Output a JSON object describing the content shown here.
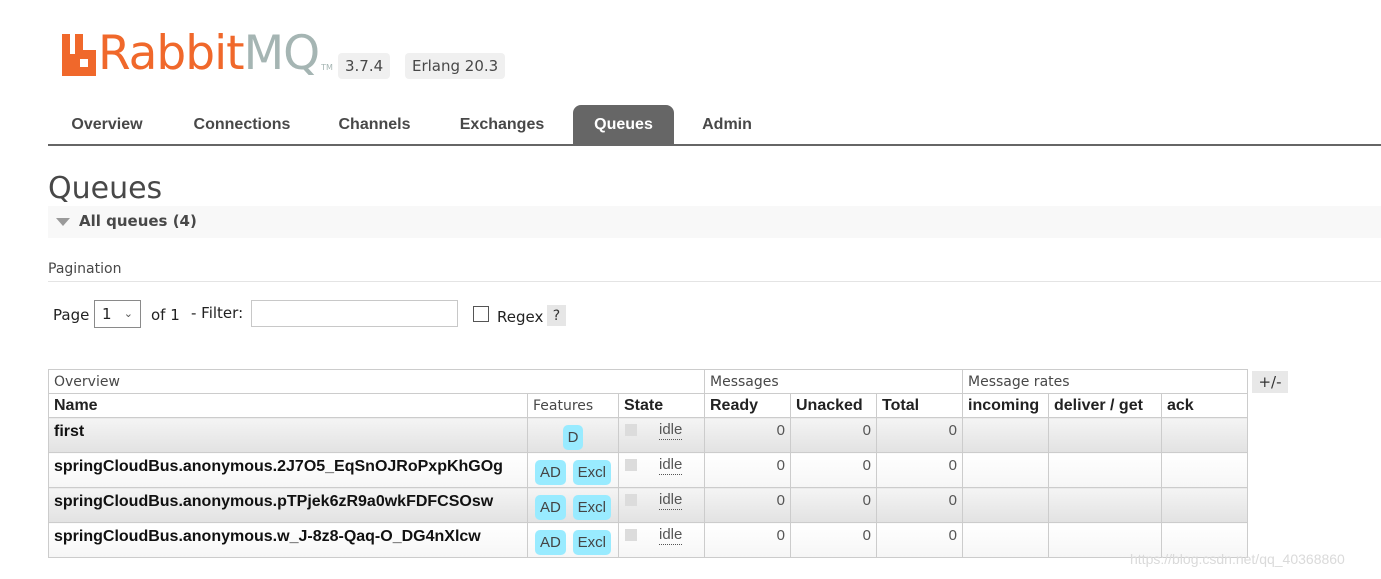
{
  "header": {
    "logo_rabbit": "Rabbit",
    "logo_mq": "MQ",
    "logo_tm": "TM",
    "version": "3.7.4",
    "erlang": "Erlang 20.3",
    "brand_color": "#f0682b"
  },
  "nav": {
    "tabs": [
      {
        "label": "Overview",
        "active": false
      },
      {
        "label": "Connections",
        "active": false
      },
      {
        "label": "Channels",
        "active": false
      },
      {
        "label": "Exchanges",
        "active": false
      },
      {
        "label": "Queues",
        "active": true
      },
      {
        "label": "Admin",
        "active": false
      }
    ]
  },
  "page": {
    "title": "Queues",
    "section_title": "All queues (4)"
  },
  "pagination": {
    "label": "Pagination",
    "page_label": "Page",
    "page_value": "1",
    "of_label": "of 1",
    "filter_label": "- Filter:",
    "filter_value": "",
    "regex_label": "Regex",
    "regex_checked": false,
    "help_label": "?"
  },
  "table": {
    "groups": {
      "overview": "Overview",
      "messages": "Messages",
      "rates": "Message rates"
    },
    "columns": {
      "name": "Name",
      "features": "Features",
      "state": "State",
      "ready": "Ready",
      "unacked": "Unacked",
      "total": "Total",
      "incoming": "incoming",
      "deliver_get": "deliver / get",
      "ack": "ack"
    },
    "toggle_columns": "+/-",
    "rows": [
      {
        "name": "first",
        "features": [
          "D"
        ],
        "state": "idle",
        "ready": "0",
        "unacked": "0",
        "total": "0",
        "incoming": "",
        "deliver_get": "",
        "ack": ""
      },
      {
        "name": "springCloudBus.anonymous.2J7O5_EqSnOJRoPxpKhGOg",
        "features": [
          "AD",
          "Excl"
        ],
        "state": "idle",
        "ready": "0",
        "unacked": "0",
        "total": "0",
        "incoming": "",
        "deliver_get": "",
        "ack": ""
      },
      {
        "name": "springCloudBus.anonymous.pTPjek6zR9a0wkFDFCSOsw",
        "features": [
          "AD",
          "Excl"
        ],
        "state": "idle",
        "ready": "0",
        "unacked": "0",
        "total": "0",
        "incoming": "",
        "deliver_get": "",
        "ack": ""
      },
      {
        "name": "springCloudBus.anonymous.w_J-8z8-Qaq-O_DG4nXlcw",
        "features": [
          "AD",
          "Excl"
        ],
        "state": "idle",
        "ready": "0",
        "unacked": "0",
        "total": "0",
        "incoming": "",
        "deliver_get": "",
        "ack": ""
      }
    ]
  },
  "watermark": "https://blog.csdn.net/qq_40368860"
}
